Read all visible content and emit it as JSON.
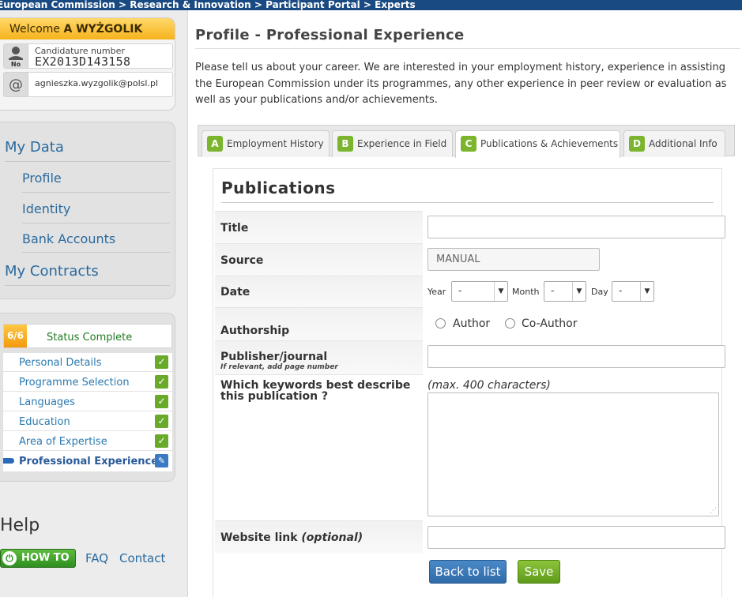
{
  "breadcrumb": {
    "text": "European Commission > Research & Innovation > Participant Portal > Experts"
  },
  "welcome": {
    "prefix": "Welcome",
    "name": "A WYŻGOLIK",
    "candidature_label": "Candidature number",
    "candidature_number": "EX2013D143158",
    "email": "agnieszka.wyzgolik@polsl.pl"
  },
  "nav": {
    "my_data": "My Data",
    "items": [
      "Profile",
      "Identity",
      "Bank Accounts"
    ],
    "my_contracts": "My Contracts"
  },
  "status": {
    "badge": "6/6",
    "text": "Status Complete",
    "items": [
      {
        "label": "Personal Details",
        "state": "complete"
      },
      {
        "label": "Programme Selection",
        "state": "complete"
      },
      {
        "label": "Languages",
        "state": "complete"
      },
      {
        "label": "Education",
        "state": "complete"
      },
      {
        "label": "Area of Expertise",
        "state": "complete"
      },
      {
        "label": "Professional Experience",
        "state": "editing"
      }
    ]
  },
  "help": {
    "title": "Help",
    "howto": "HOW TO",
    "faq": "FAQ",
    "contact": "Contact"
  },
  "page": {
    "title": "Profile - Professional Experience",
    "intro": "Please tell us about your career. We are interested in your employment history, experience in assisting the European Commission under its programmes, any other experience in peer review or evaluation as well as your publications and/or achievements."
  },
  "tabs": [
    {
      "letter": "A",
      "label": "Employment History",
      "active": false
    },
    {
      "letter": "B",
      "label": "Experience in Field",
      "active": false
    },
    {
      "letter": "C",
      "label": "Publications & Achievements",
      "active": true
    },
    {
      "letter": "D",
      "label": "Additional Info",
      "active": false
    }
  ],
  "form": {
    "section_title": "Publications",
    "title_label": "Title",
    "title_value": "",
    "source_label": "Source",
    "source_value": "MANUAL",
    "date_label": "Date",
    "year_label": "Year",
    "year_value": "-",
    "month_label": "Month",
    "month_value": "-",
    "day_label": "Day",
    "day_value": "-",
    "authorship_label": "Authorship",
    "author_option": "Author",
    "coauthor_option": "Co-Author",
    "publisher_label": "Publisher/journal",
    "publisher_hint": "If relevant, add page number",
    "publisher_value": "",
    "keywords_label": "Which keywords best describe this publication ?",
    "keywords_hint": "(max. 400 characters)",
    "keywords_value": "",
    "website_label": "Website link",
    "website_optional": "(optional)",
    "website_value": "",
    "back_button": "Back to list",
    "save_button": "Save"
  },
  "colors": {
    "accent_green": "#7bb52e",
    "link_blue": "#2a6a9e",
    "top_bar": "#1a4a82",
    "welcome_orange": "#f6b31c"
  }
}
